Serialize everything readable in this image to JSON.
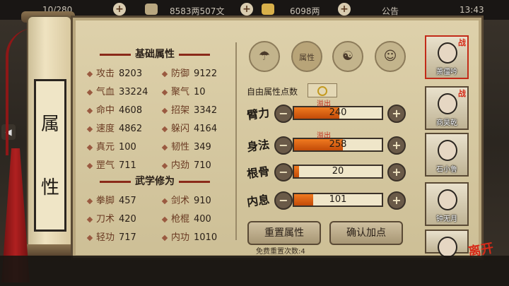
{
  "topbar": {
    "stamina": "10/280",
    "money": "8583两507文",
    "gold": "6098两",
    "notice": "公告",
    "time": "13:43"
  },
  "scroll_title": [
    "属",
    "性"
  ],
  "base_header": "基础属性",
  "base_stats": [
    {
      "label": "攻击",
      "value": "8203"
    },
    {
      "label": "防御",
      "value": "9122"
    },
    {
      "label": "气血",
      "value": "33224"
    },
    {
      "label": "聚气",
      "value": "10"
    },
    {
      "label": "命中",
      "value": "4608"
    },
    {
      "label": "招架",
      "value": "3342"
    },
    {
      "label": "速度",
      "value": "4862"
    },
    {
      "label": "躲闪",
      "value": "4164"
    },
    {
      "label": "真元",
      "value": "100"
    },
    {
      "label": "韧性",
      "value": "349"
    },
    {
      "label": "罡气",
      "value": "711"
    },
    {
      "label": "内劲",
      "value": "710"
    }
  ],
  "martial_header": "武学修为",
  "martial_stats": [
    {
      "label": "拳脚",
      "value": "457"
    },
    {
      "label": "剑术",
      "value": "910"
    },
    {
      "label": "刀术",
      "value": "420"
    },
    {
      "label": "枪棍",
      "value": "400"
    },
    {
      "label": "轻功",
      "value": "717"
    },
    {
      "label": "内功",
      "value": "1010"
    }
  ],
  "tabs": [
    {
      "icon": "hat-icon"
    },
    {
      "icon": "attribute-chest-icon",
      "label": "属性"
    },
    {
      "icon": "taiji-icon"
    },
    {
      "icon": "body-figure-icon"
    }
  ],
  "free_points_label": "自由属性点数",
  "free_points_value": "0",
  "attributes": [
    {
      "name": "臂力",
      "value": "240",
      "fill_fraction": 0.52,
      "overflow": "溢出"
    },
    {
      "name": "身法",
      "value": "258",
      "fill_fraction": 0.56,
      "overflow": "溢出"
    },
    {
      "name": "根骨",
      "value": "20",
      "fill_fraction": 0.06,
      "overflow": ""
    },
    {
      "name": "内息",
      "value": "101",
      "fill_fraction": 0.22,
      "overflow": ""
    }
  ],
  "buttons": {
    "reset": "重置属性",
    "confirm": "确认加点"
  },
  "reset_note": "免费重置次数:4",
  "party": [
    {
      "name": "萧僵吟",
      "tag": "战"
    },
    {
      "name": "商昊乾",
      "tag": "战"
    },
    {
      "name": "石小鲁",
      "tag": ""
    },
    {
      "name": "钟无月",
      "tag": ""
    },
    {
      "name": "",
      "tag": ""
    }
  ],
  "leave_label": "离开",
  "colors": {
    "accent_red": "#c22a18",
    "bar_orange": "#e8691a",
    "parchment": "#d8caa2"
  }
}
